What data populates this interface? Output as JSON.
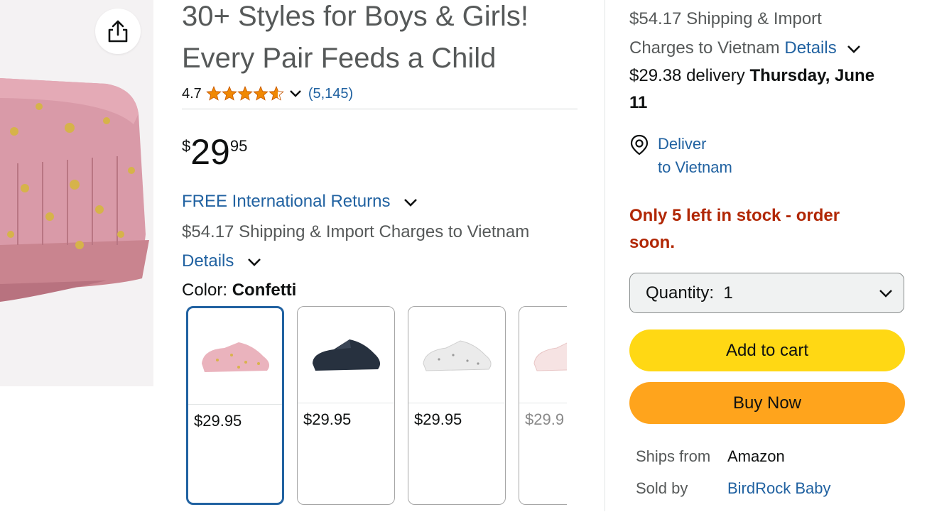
{
  "product": {
    "title_line1": "30+ Styles for Boys & Girls!",
    "title_line2": "Every Pair Feeds a Child",
    "rating": "4.7",
    "review_count": "(5,145)",
    "price_symbol": "$",
    "price_whole": "29",
    "price_fraction": "95",
    "returns_label": "FREE International Returns",
    "shipping_text": "$54.17 Shipping & Import Charges to Vietnam",
    "details_label": "Details",
    "color_label": "Color:",
    "color_value": "Confetti",
    "swatches": [
      {
        "price": "$29.95",
        "color": "#e9b6bd",
        "selected": true
      },
      {
        "price": "$29.95",
        "color": "#27313f",
        "selected": false
      },
      {
        "price": "$29.95",
        "color": "#eeeeee",
        "selected": false
      },
      {
        "price": "$29.9",
        "color": "#f6e3e3",
        "selected": false
      }
    ]
  },
  "buybox": {
    "shipping_line1": "$54.17 Shipping & Import",
    "shipping_line2": "Charges to Vietnam",
    "details_label": "Details",
    "delivery_price": "$29.38 delivery",
    "delivery_date_a": "Thursday, June",
    "delivery_date_b": "11",
    "deliver_line1": "Deliver",
    "deliver_line2": "to Vietnam",
    "stock_line1": "Only 5 left in stock - order",
    "stock_line2": "soon.",
    "quantity_label": "Quantity:",
    "quantity_value": "1",
    "add_to_cart": "Add to cart",
    "buy_now": "Buy Now",
    "ships_from_label": "Ships from",
    "ships_from_value": "Amazon",
    "sold_by_label": "Sold by",
    "sold_by_value": "BirdRock Baby"
  },
  "colors": {
    "link": "#2162a1",
    "stock_red": "#b12704",
    "add_to_cart": "#ffd814",
    "buy_now": "#ffa41c",
    "star": "#f08804"
  }
}
